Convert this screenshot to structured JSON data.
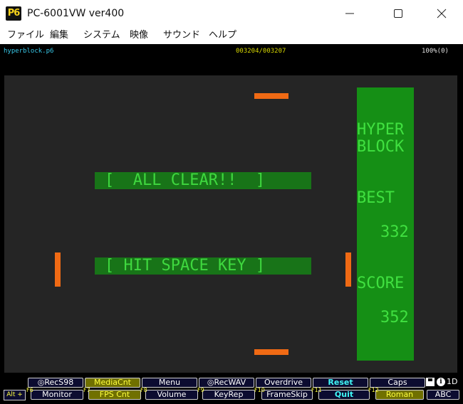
{
  "window": {
    "icon_text": "P6",
    "title": "PC-6001VW ver400"
  },
  "menu": [
    "ファイル",
    "編集",
    "システム",
    "映像",
    "サウンド",
    "ヘルプ"
  ],
  "status": {
    "filename": "hyperblock.p6",
    "counter": "003204/003207",
    "speed": "100%(0)"
  },
  "game": {
    "banner_clear": "[  ALL CLEAR!!  ]",
    "banner_hit": "[ HIT SPACE KEY ]",
    "title_line1": "HYPER",
    "title_line2": "BLOCK",
    "best_label": "BEST",
    "best_value": "332",
    "score_label": "SCORE",
    "score_value": "352",
    "colors": {
      "playfield": "#252525",
      "paddle": "#f06a14",
      "banner_bg": "#187418",
      "panel_bg": "#158f15",
      "text_green": "#40e040"
    }
  },
  "fkeys": {
    "alt": "Alt +",
    "top": [
      "◎RecS98",
      "MediaCnt",
      "Menu",
      "◎RecWAV",
      "Overdrive",
      "Reset",
      "Caps"
    ],
    "bottom": [
      "Monitor",
      "FPS Cnt",
      "Volume",
      "KeyRep",
      "FrameSkip",
      "Quit",
      "Roman",
      "ABC"
    ],
    "numbers": [
      "F6",
      "F7",
      "F8",
      "F9",
      "F10",
      "F11",
      "F12"
    ]
  },
  "tray": {
    "drive": "1D"
  }
}
